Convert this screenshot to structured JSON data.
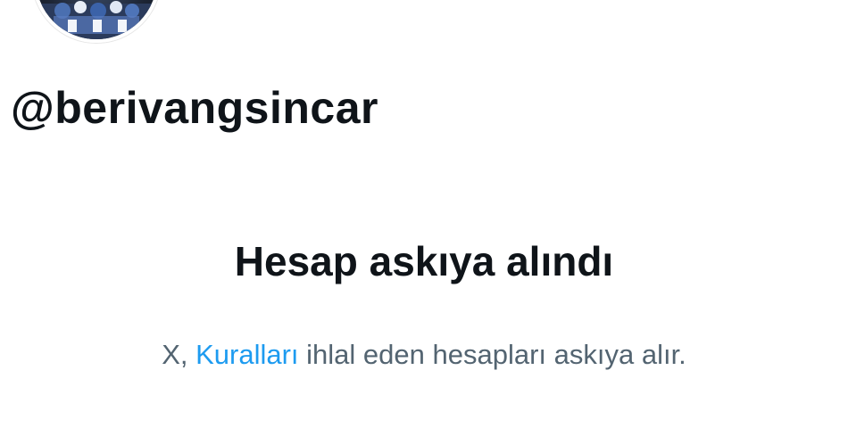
{
  "profile": {
    "handle": "@berivangsincar"
  },
  "suspension": {
    "title": "Hesap askıya alındı",
    "desc_prefix": "X, ",
    "rules_link": "Kuralları",
    "desc_suffix": " ihlal eden hesapları askıya alır."
  },
  "colors": {
    "text_primary": "#0f1419",
    "text_secondary": "#536471",
    "link": "#1d9bf0",
    "background": "#ffffff"
  }
}
